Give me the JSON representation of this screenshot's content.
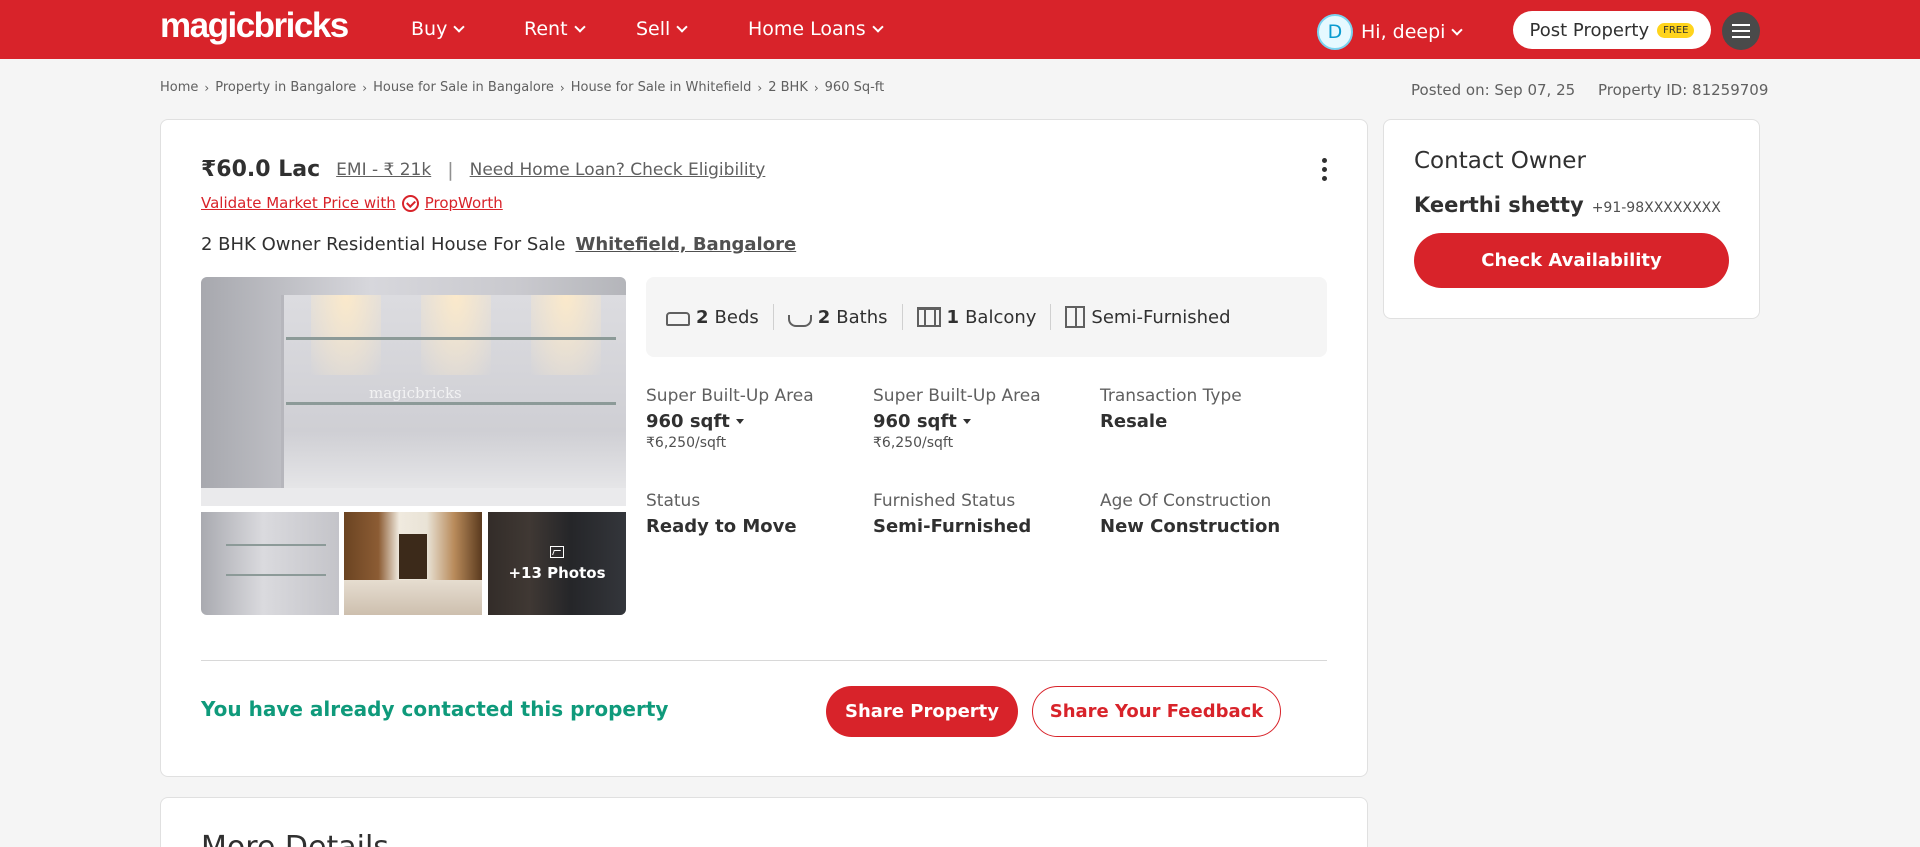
{
  "header": {
    "logo": "magicbricks",
    "nav": [
      {
        "label": "Buy"
      },
      {
        "label": "Rent"
      },
      {
        "label": "Sell"
      },
      {
        "label": "Home Loans"
      }
    ],
    "user_initial": "D",
    "user_greeting": "Hi, deepi",
    "post_property_label": "Post Property",
    "free_badge": "FREE",
    "brand_color": "#d8232a"
  },
  "breadcrumb": [
    "Home",
    "Property in Bangalore",
    "House for Sale in Bangalore",
    "House for Sale in Whitefield",
    "2 BHK",
    "960 Sq-ft"
  ],
  "posted_on": "Posted on: Sep 07, 25",
  "property_id": "Property ID: 81259709",
  "listing": {
    "price": "₹60.0 Lac",
    "emi": "EMI - ₹ 21k",
    "loan_link": "Need Home Loan? Check Eligibility",
    "validate_text": "Validate Market Price with",
    "propworth": "PropWorth",
    "title": "2 BHK Owner Residential House For Sale",
    "location": "Whitefield, Bangalore",
    "photo_watermark": "magicbricks",
    "more_photos": "+13 Photos",
    "features": {
      "beds_count": "2",
      "beds_label": "Beds",
      "baths_count": "2",
      "baths_label": "Baths",
      "balcony_count": "1",
      "balcony_label": "Balcony",
      "furnishing": "Semi-Furnished"
    },
    "specs": [
      {
        "label": "Super Built-Up Area",
        "value": "960 sqft",
        "sub": "₹6,250/sqft"
      },
      {
        "label": "Super Built-Up Area",
        "value": "960 sqft",
        "sub": "₹6,250/sqft"
      },
      {
        "label": "Transaction Type",
        "value": "Resale"
      },
      {
        "label": "Status",
        "value": "Ready to Move"
      },
      {
        "label": "Furnished Status",
        "value": "Semi-Furnished"
      },
      {
        "label": "Age Of Construction",
        "value": "New Construction"
      }
    ],
    "contacted_text": "You have already contacted this property",
    "share_label": "Share Property",
    "feedback_label": "Share Your Feedback",
    "contacted_color": "#0f9a7b"
  },
  "more_details_title": "More Details",
  "contact": {
    "title": "Contact Owner",
    "owner_name": "Keerthi shetty",
    "owner_phone": "+91-98XXXXXXXX",
    "button_label": "Check Availability"
  }
}
